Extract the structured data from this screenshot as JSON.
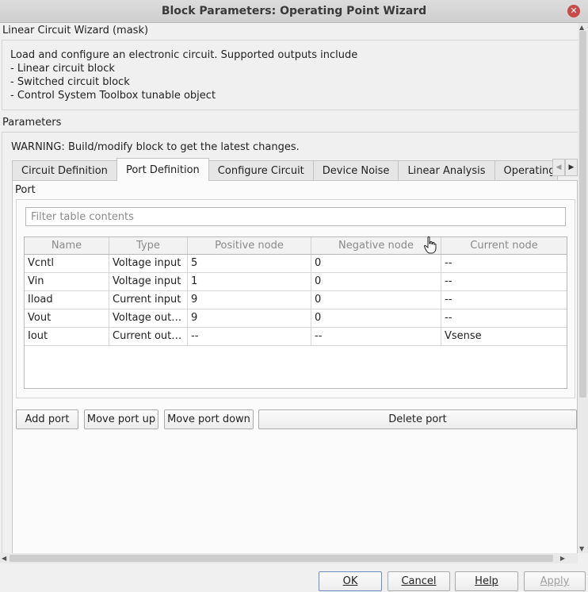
{
  "window": {
    "title": "Block Parameters: Operating Point Wizard"
  },
  "mask": {
    "title": "Linear Circuit Wizard (mask)",
    "description": [
      "Load and configure an electronic circuit. Supported outputs include",
      "- Linear circuit block",
      "- Switched circuit block",
      "- Control System Toolbox tunable object"
    ]
  },
  "parameters": {
    "title": "Parameters",
    "warning": "WARNING: Build/modify block to get the latest changes."
  },
  "tabs": [
    {
      "label": "Circuit Definition",
      "active": false
    },
    {
      "label": "Port Definition",
      "active": true
    },
    {
      "label": "Configure Circuit",
      "active": false
    },
    {
      "label": "Device Noise",
      "active": false
    },
    {
      "label": "Linear Analysis",
      "active": false
    },
    {
      "label": "Operating",
      "active": false
    }
  ],
  "port": {
    "label": "Port",
    "filter_placeholder": "Filter table contents",
    "filter_value": "",
    "columns": [
      "Name",
      "Type",
      "Positive node",
      "Negative node",
      "Current node"
    ],
    "rows": [
      [
        "Vcntl",
        "Voltage input",
        "5",
        "0",
        "--"
      ],
      [
        "Vin",
        "Voltage input",
        "1",
        "0",
        "--"
      ],
      [
        "Iload",
        "Current input",
        "9",
        "0",
        "--"
      ],
      [
        "Vout",
        "Voltage out…",
        "9",
        "0",
        "--"
      ],
      [
        "Iout",
        "Current out…",
        "--",
        "--",
        "Vsense"
      ]
    ],
    "buttons": {
      "add": "Add port",
      "up": "Move port up",
      "down": "Move port down",
      "delete": "Delete port"
    }
  },
  "dialog_buttons": {
    "ok": "OK",
    "cancel": "Cancel",
    "help": "Help",
    "apply": "Apply"
  },
  "icons": {
    "close": "close-icon",
    "tab_left": "chevron-left-icon",
    "tab_right": "chevron-right-icon",
    "cursor": "hand-pointer-icon"
  },
  "colors": {
    "close_button": "#c94a4a",
    "ok_border": "#6a8cc0"
  }
}
